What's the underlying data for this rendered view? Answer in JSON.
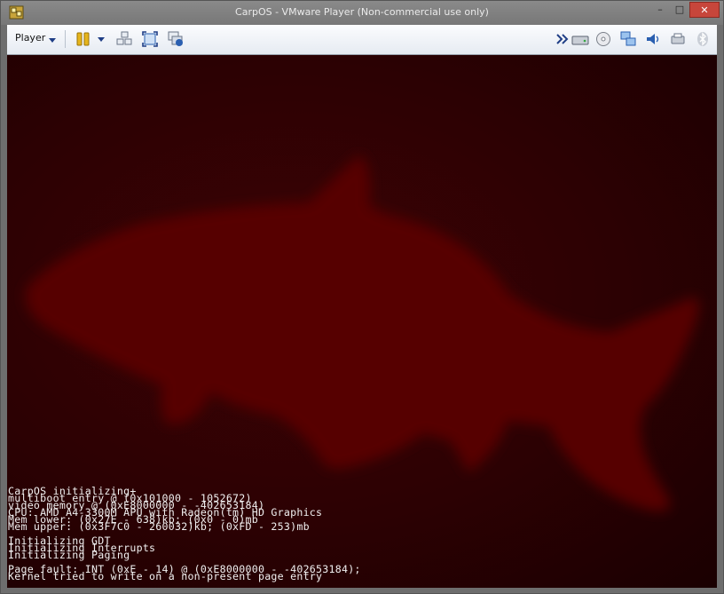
{
  "window": {
    "title": "CarpOS - VMware Player (Non-commercial use only)",
    "minimize": "–",
    "maximize": "□",
    "close": "✕"
  },
  "toolbar": {
    "player_menu_label": "Player",
    "left_icons": [
      "pause-icon",
      "send-ctrl-alt-del-icon",
      "fullscreen-icon",
      "unity-icon"
    ],
    "right_icons": [
      "more-icon",
      "hard-disk-icon",
      "cd-dvd-icon",
      "network-adapter-icon",
      "sound-card-icon",
      "printer-icon",
      "bluetooth-icon"
    ]
  },
  "console": {
    "lines": [
      "CarpOS initializing+",
      "multiboot entry @ (0x101000 - 1052672)",
      "video memory @ (0xE8000000 - -402653184)",
      "CPU: AMD A4-3300M APU with Radeon(tm) HD Graphics",
      "Mem lower: (0x27E - 638)kb; (0x0 - 0)mb",
      "Mem upper: (0x3F7C0 - 260032)kb; (0xFD - 253)mb",
      "",
      "Initializing GDT",
      "Initializing Interrupts",
      "Initializing Paging",
      "",
      "Page fault: INT (0xE - 14) @ (0xE8000000 - -402653184);",
      "Kernel tried to write on a non-present page entry"
    ]
  },
  "colors": {
    "display_bg": "#2c0103",
    "fish": "#560203",
    "console_text": "#f0f0f0",
    "toolbar_icon_blue": "#2a5fb0",
    "pause_yellow": "#e6b51c",
    "close_button": "#c7463b"
  }
}
